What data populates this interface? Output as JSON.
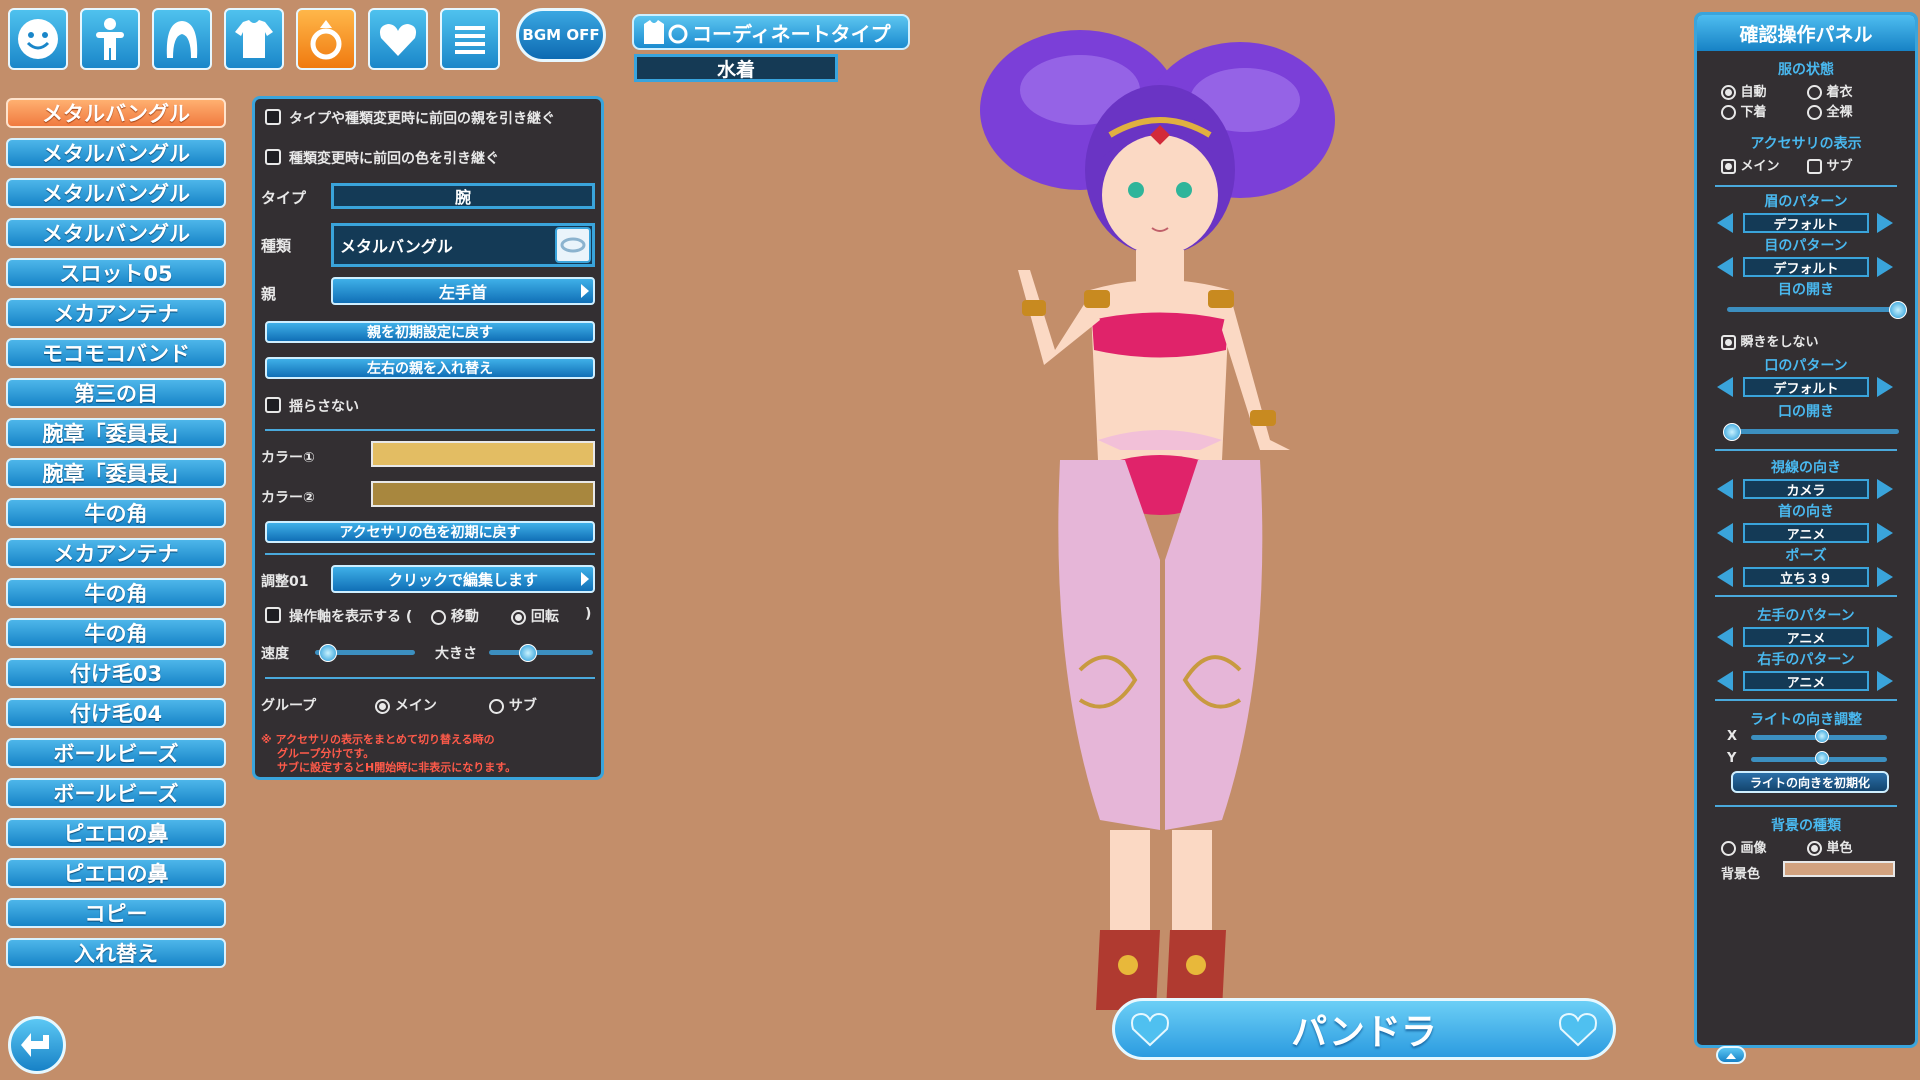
{
  "toolbar": {
    "icons": [
      "face-icon",
      "body-icon",
      "hair-icon",
      "clothes-icon",
      "accessory-icon",
      "heart-icon",
      "menu-icon"
    ],
    "bgm_label": "BGM OFF"
  },
  "coordinate": {
    "title": "コーディネートタイプ",
    "value": "水着"
  },
  "slots": [
    "メタルバングル",
    "メタルバングル",
    "メタルバングル",
    "メタルバングル",
    "スロット05",
    "メカアンテナ",
    "モコモコバンド",
    "第三の目",
    "腕章「委員長」",
    "腕章「委員長」",
    "牛の角",
    "メカアンテナ",
    "牛の角",
    "牛の角",
    "付け毛03",
    "付け毛04",
    "ボールビーズ",
    "ボールビーズ",
    "ピエロの鼻",
    "ピエロの鼻",
    "コピー",
    "入れ替え"
  ],
  "panel": {
    "check_keep_parent": "タイプや種類変更時に前回の親を引き継ぐ",
    "check_keep_color": "種類変更時に前回の色を引き継ぐ",
    "type_label": "タイプ",
    "type_value": "腕",
    "kind_label": "種類",
    "kind_value": "メタルバングル",
    "parent_label": "親",
    "parent_value": "左手首",
    "reset_parent": "親を初期設定に戻す",
    "swap_parent": "左右の親を入れ替え",
    "no_shake": "揺らさない",
    "color1_label": "カラー①",
    "color1": "#e3bd63",
    "color2_label": "カラー②",
    "color2": "#a8873e",
    "reset_color": "アクセサリの色を初期に戻す",
    "adjust_label": "調整01",
    "adjust_value": "クリックで編集します",
    "show_axis": "操作軸を表示する (",
    "move": "移動",
    "rotate": "回転",
    "paren_close": ")",
    "speed": "速度",
    "size": "大きさ",
    "group": "グループ",
    "main": "メイン",
    "sub": "サブ",
    "note1": "※ アクセサリの表示をまとめて切り替える時の",
    "note2": "グループ分けです。",
    "note3": "サブに設定するとH開始時に非表示になります。"
  },
  "right_panel": {
    "title": "確認操作パネル",
    "clothes_state": "服の状態",
    "auto": "自動",
    "dressed": "着衣",
    "underwear": "下着",
    "nude": "全裸",
    "acc_display": "アクセサリの表示",
    "acc_main": "メイン",
    "acc_sub": "サブ",
    "brow_pattern": "眉のパターン",
    "brow_value": "デフォルト",
    "eye_pattern": "目のパターン",
    "eye_value": "デフォルト",
    "eye_open": "目の開き",
    "no_blink": "瞬きをしない",
    "mouth_pattern": "口のパターン",
    "mouth_value": "デフォルト",
    "mouth_open": "口の開き",
    "gaze": "視線の向き",
    "gaze_value": "カメラ",
    "neck": "首の向き",
    "neck_value": "アニメ",
    "pose": "ポーズ",
    "pose_value": "立ち３９",
    "left_hand": "左手のパターン",
    "left_hand_value": "アニメ",
    "right_hand": "右手のパターン",
    "right_hand_value": "アニメ",
    "light_adjust": "ライトの向き調整",
    "x": "X",
    "y": "Y",
    "light_reset": "ライトの向きを初期化",
    "bg_kind": "背景の種類",
    "bg_image": "画像",
    "bg_solid": "単色",
    "bg_color_label": "背景色",
    "bg_color": "#d2a27f"
  },
  "character_name": "パンドラ"
}
